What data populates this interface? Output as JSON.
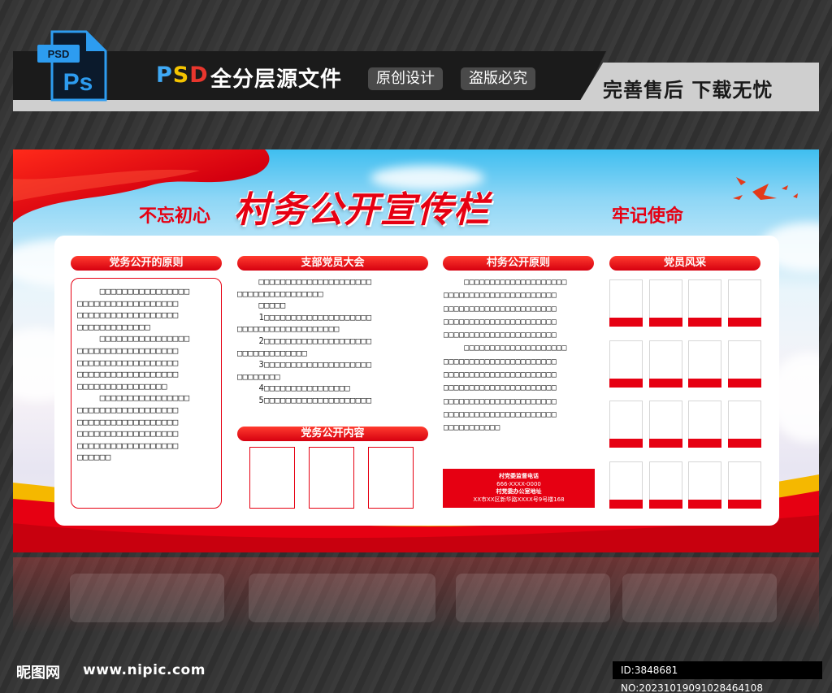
{
  "header": {
    "ps_badge": "PSD",
    "ps_letters": "Ps",
    "psd_label": [
      "P",
      "S",
      "D"
    ],
    "title": "全分层源文件",
    "pill_original": "原创设计",
    "pill_piracy": "盗版必究",
    "slogan": "完善售后 下载无忧"
  },
  "board": {
    "title": "村务公开宣传栏",
    "left_slogan": "不忘初心",
    "right_slogan": "牢记使命",
    "sections": {
      "party_principle": "党务公开的原则",
      "branch_meeting": "支部党员大会",
      "party_content": "党务公开内容",
      "village_principle": "村务公开原则",
      "member_style": "党员风采"
    },
    "col1_text": "    □□□□□□□□□□□□□□□□\n□□□□□□□□□□□□□□□□□□\n□□□□□□□□□□□□□□□□□□\n□□□□□□□□□□□□□\n    □□□□□□□□□□□□□□□□\n□□□□□□□□□□□□□□□□□□\n□□□□□□□□□□□□□□□□□□\n□□□□□□□□□□□□□□□□□□\n□□□□□□□□□□□□□□□□\n    □□□□□□□□□□□□□□□□\n□□□□□□□□□□□□□□□□□□\n□□□□□□□□□□□□□□□□□□\n□□□□□□□□□□□□□□□□□□\n□□□□□□□□□□□□□□□□□□\n□□□□□□",
    "col2_text": "    □□□□□□□□□□□□□□□□□□□□□\n□□□□□□□□□□□□□□□□\n    □□□□□\n    1□□□□□□□□□□□□□□□□□□□□\n□□□□□□□□□□□□□□□□□□□\n    2□□□□□□□□□□□□□□□□□□□□\n□□□□□□□□□□□□□\n    3□□□□□□□□□□□□□□□□□□□□\n□□□□□□□□\n    4□□□□□□□□□□□□□□□□\n    5□□□□□□□□□□□□□□□□□□□□",
    "col3_text": "    □□□□□□□□□□□□□□□□□□□□\n□□□□□□□□□□□□□□□□□□□□□□\n□□□□□□□□□□□□□□□□□□□□□□\n□□□□□□□□□□□□□□□□□□□□□□\n□□□□□□□□□□□□□□□□□□□□□□\n    □□□□□□□□□□□□□□□□□□□□\n□□□□□□□□□□□□□□□□□□□□□□\n□□□□□□□□□□□□□□□□□□□□□□\n□□□□□□□□□□□□□□□□□□□□□□\n□□□□□□□□□□□□□□□□□□□□□□\n□□□□□□□□□□□□□□□□□□□□□□\n□□□□□□□□□□□",
    "contact": {
      "line1": "村党委监督电话",
      "line2": "666-XXXX-0000",
      "line3": "村党委办公室地址",
      "line4": "XX市XX区新华路XXXX号9号楼168"
    }
  },
  "footer": {
    "logo": "昵图网",
    "url": "www.nipic.com",
    "id": "ID:3848681 NO:20231019091028464108"
  }
}
